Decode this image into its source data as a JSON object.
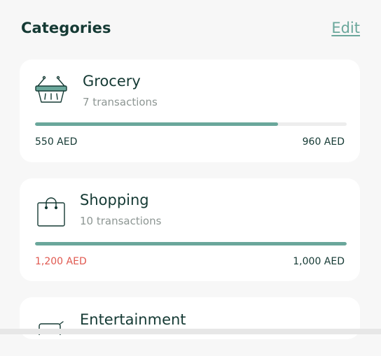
{
  "header": {
    "title": "Categories",
    "edit_label": "Edit"
  },
  "colors": {
    "accent": "#6aa79b",
    "heading": "#153a34",
    "over_budget": "#e0584f"
  },
  "categories": [
    {
      "name": "Grocery",
      "icon": "basket-icon",
      "count_text": "7 transactions",
      "spent": "550 AED",
      "budget": "960 AED",
      "progress_percent": 78,
      "over_budget": false
    },
    {
      "name": "Shopping",
      "icon": "shopping-bag-icon",
      "count_text": "10 transactions",
      "spent": "1,200 AED",
      "budget": "1,000 AED",
      "progress_percent": 100,
      "over_budget": true
    },
    {
      "name": "Entertainment",
      "icon": "tv-icon"
    }
  ]
}
